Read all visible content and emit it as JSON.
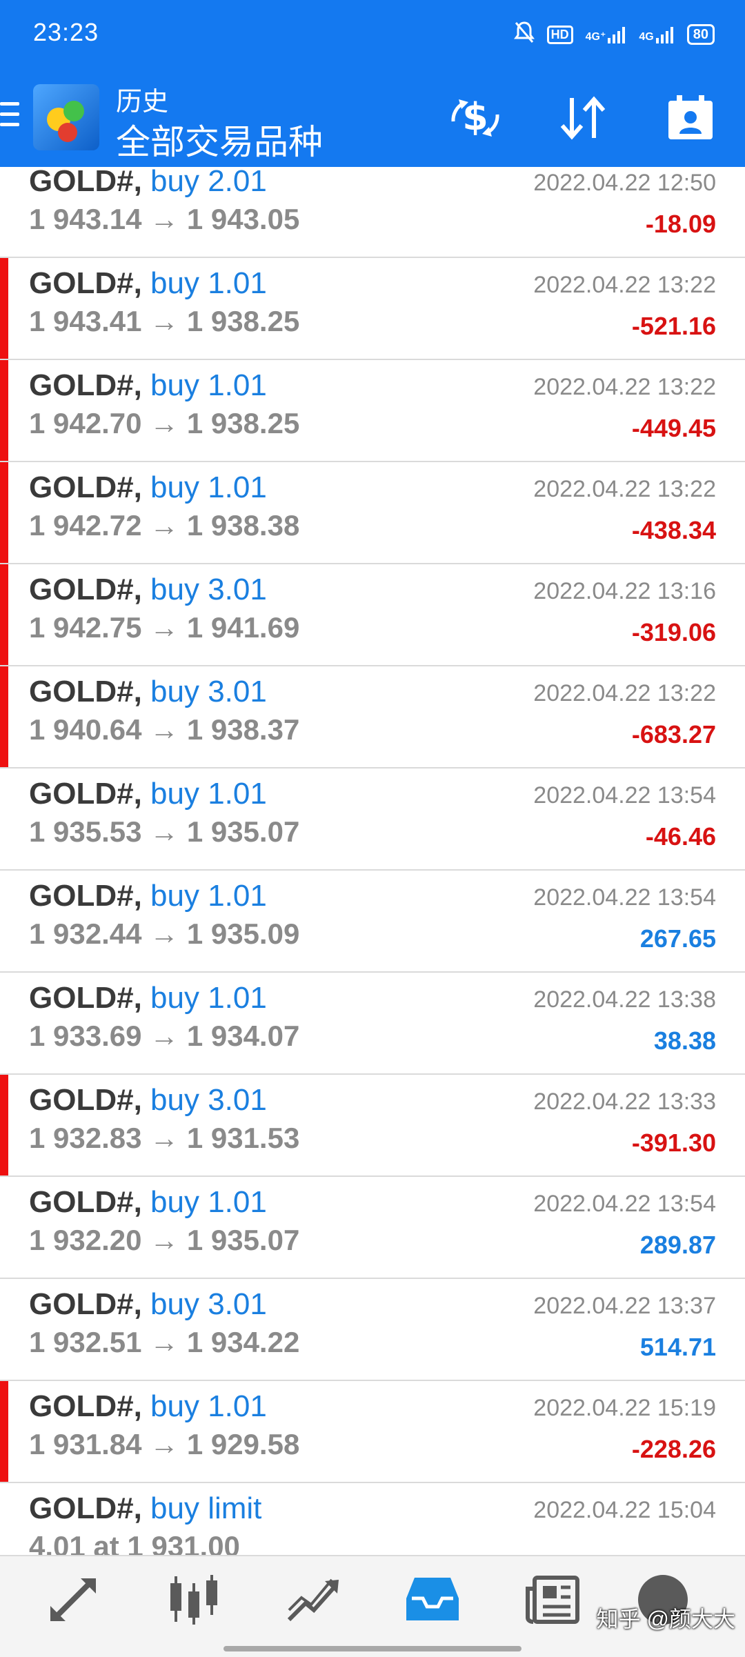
{
  "status_bar": {
    "time": "23:23",
    "battery": "80",
    "net1": "4G⁺",
    "net2": "4G",
    "hd": "HD"
  },
  "toolbar": {
    "title": "历史",
    "subtitle": "全部交易品种"
  },
  "trades": [
    {
      "symbol": "GOLD#,",
      "action": "buy 2.01",
      "prices": "1 943.14 → 1 943.05",
      "time": "2022.04.22 12:50",
      "profit": "-18.09",
      "sign": "neg",
      "marker": false
    },
    {
      "symbol": "GOLD#,",
      "action": "buy 1.01",
      "prices": "1 943.41 → 1 938.25",
      "time": "2022.04.22 13:22",
      "profit": "-521.16",
      "sign": "neg",
      "marker": true
    },
    {
      "symbol": "GOLD#,",
      "action": "buy 1.01",
      "prices": "1 942.70 → 1 938.25",
      "time": "2022.04.22 13:22",
      "profit": "-449.45",
      "sign": "neg",
      "marker": true
    },
    {
      "symbol": "GOLD#,",
      "action": "buy 1.01",
      "prices": "1 942.72 → 1 938.38",
      "time": "2022.04.22 13:22",
      "profit": "-438.34",
      "sign": "neg",
      "marker": true
    },
    {
      "symbol": "GOLD#,",
      "action": "buy 3.01",
      "prices": "1 942.75 → 1 941.69",
      "time": "2022.04.22 13:16",
      "profit": "-319.06",
      "sign": "neg",
      "marker": true
    },
    {
      "symbol": "GOLD#,",
      "action": "buy 3.01",
      "prices": "1 940.64 → 1 938.37",
      "time": "2022.04.22 13:22",
      "profit": "-683.27",
      "sign": "neg",
      "marker": true
    },
    {
      "symbol": "GOLD#,",
      "action": "buy 1.01",
      "prices": "1 935.53 → 1 935.07",
      "time": "2022.04.22 13:54",
      "profit": "-46.46",
      "sign": "neg",
      "marker": false
    },
    {
      "symbol": "GOLD#,",
      "action": "buy 1.01",
      "prices": "1 932.44 → 1 935.09",
      "time": "2022.04.22 13:54",
      "profit": "267.65",
      "sign": "pos",
      "marker": false
    },
    {
      "symbol": "GOLD#,",
      "action": "buy 1.01",
      "prices": "1 933.69 → 1 934.07",
      "time": "2022.04.22 13:38",
      "profit": "38.38",
      "sign": "pos",
      "marker": false
    },
    {
      "symbol": "GOLD#,",
      "action": "buy 3.01",
      "prices": "1 932.83 → 1 931.53",
      "time": "2022.04.22 13:33",
      "profit": "-391.30",
      "sign": "neg",
      "marker": true
    },
    {
      "symbol": "GOLD#,",
      "action": "buy 1.01",
      "prices": "1 932.20 → 1 935.07",
      "time": "2022.04.22 13:54",
      "profit": "289.87",
      "sign": "pos",
      "marker": false
    },
    {
      "symbol": "GOLD#,",
      "action": "buy 3.01",
      "prices": "1 932.51 → 1 934.22",
      "time": "2022.04.22 13:37",
      "profit": "514.71",
      "sign": "pos",
      "marker": false
    },
    {
      "symbol": "GOLD#,",
      "action": "buy 1.01",
      "prices": "1 931.84 → 1 929.58",
      "time": "2022.04.22 15:19",
      "profit": "-228.26",
      "sign": "neg",
      "marker": true
    },
    {
      "symbol": "GOLD#,",
      "action": "buy limit",
      "prices": "4.01 at 1 931.00",
      "time": "2022.04.22 15:04",
      "profit": "",
      "sign": "pos",
      "marker": false
    }
  ],
  "bottom_nav": {
    "watermark": "知乎 @颜大大"
  },
  "colors": {
    "header": "#1479f0",
    "negative": "#d81212",
    "positive": "#1a7fe0",
    "marker": "#ee1010"
  }
}
